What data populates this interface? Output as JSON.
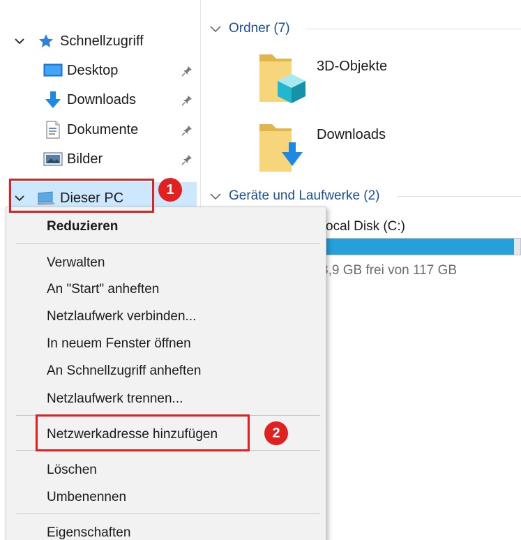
{
  "nav": {
    "quick_access": "Schnellzugriff",
    "items": [
      {
        "label": "Desktop",
        "icon": "desktop-icon"
      },
      {
        "label": "Downloads",
        "icon": "download-arrow-icon"
      },
      {
        "label": "Dokumente",
        "icon": "document-icon"
      },
      {
        "label": "Bilder",
        "icon": "pictures-icon"
      }
    ],
    "this_pc": "Dieser PC"
  },
  "content": {
    "folders_header": "Ordner (7)",
    "folders": [
      {
        "label": "3D-Objekte",
        "icon": "3d-objects-folder-icon"
      },
      {
        "label": "Downloads",
        "icon": "downloads-folder-icon"
      }
    ],
    "devices_header": "Geräte und Laufwerke (2)",
    "drive": {
      "name": "ocal Disk (C:)",
      "free_text": "3,9 GB frei von 117 GB",
      "usage_fraction": 0.97
    }
  },
  "context_menu": {
    "items": [
      {
        "label": "Reduzieren",
        "bold": true
      },
      {
        "label": "Verwalten"
      },
      {
        "label": "An \"Start\" anheften"
      },
      {
        "label": "Netzlaufwerk verbinden..."
      },
      {
        "label": "In neuem Fenster öffnen"
      },
      {
        "label": "An Schnellzugriff anheften"
      },
      {
        "label": "Netzlaufwerk trennen..."
      },
      {
        "label": "Netzwerkadresse hinzufügen"
      },
      {
        "label": "Löschen"
      },
      {
        "label": "Umbenennen"
      },
      {
        "label": "Eigenschaften"
      }
    ]
  },
  "annotations": {
    "step1": "1",
    "step2": "2"
  },
  "colors": {
    "accent": "#0078d7",
    "selection": "#cce8ff",
    "callout": "#e0211f",
    "group_header": "#1e4e94"
  }
}
